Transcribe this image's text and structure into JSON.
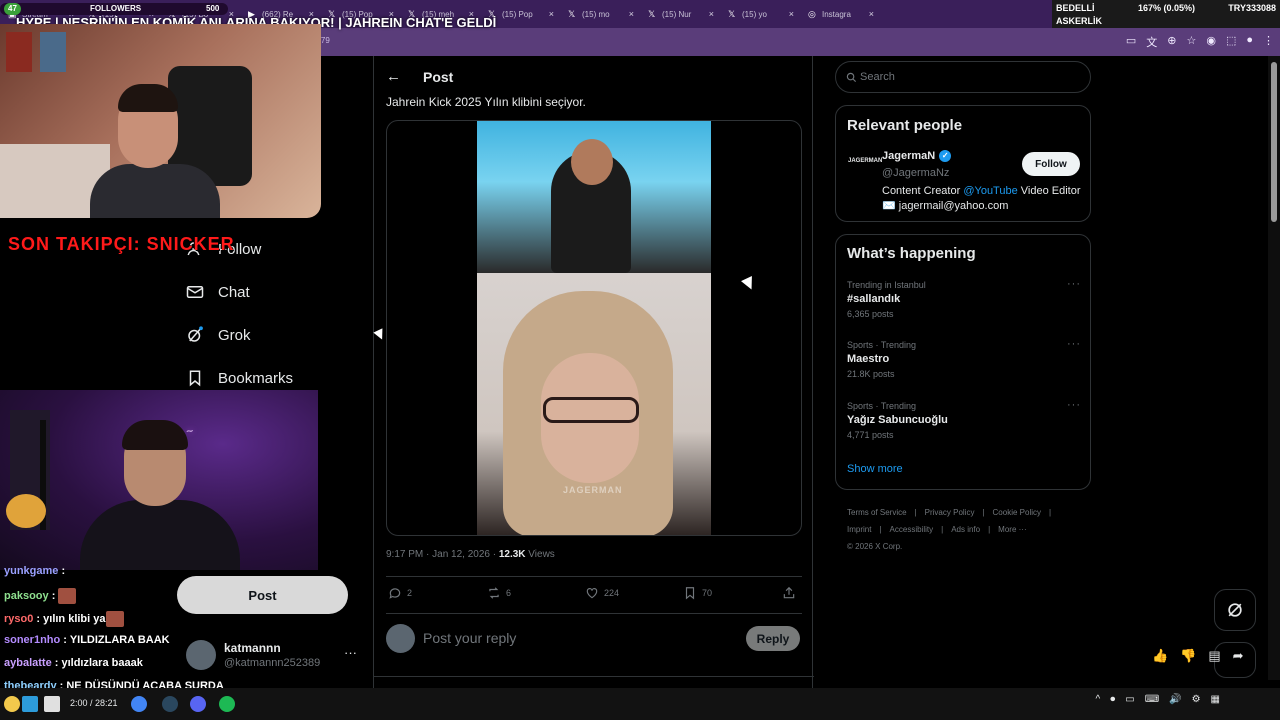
{
  "browser": {
    "tabs": [
      {
        "label": "Stream",
        "icon": "twitch-icon"
      },
      {
        "label": "(15)",
        "icon": "x-logo-icon"
      },
      {
        "label": "(15) Bo",
        "icon": "x-logo-icon"
      },
      {
        "label": "(662) Re",
        "icon": "youtube-icon"
      },
      {
        "label": "(15) Pop",
        "icon": "x-logo-icon"
      },
      {
        "label": "(15) meh",
        "icon": "x-logo-icon"
      },
      {
        "label": "(15) Pop",
        "icon": "x-logo-icon"
      },
      {
        "label": "(15) mo",
        "icon": "x-logo-icon"
      },
      {
        "label": "(15) Nur",
        "icon": "x-logo-icon"
      },
      {
        "label": "(15) yo",
        "icon": "x-logo-icon"
      },
      {
        "label": "Instagra",
        "icon": "instagram-icon"
      }
    ],
    "url_fragment": "1979"
  },
  "ticker": {
    "line1": "BEDELLİ",
    "line2": "ASKERLİK",
    "pct": "167% (0.05%)",
    "symbol": "TRY333088"
  },
  "stream": {
    "title": "HYPE | NESRİN'İN EN KOMİK ANLARINA BAKIYOR! | JAHREIN CHAT'E GELDİ",
    "followers_label": "FOLLOWERS",
    "followers_count": "47",
    "followers_goal": "500",
    "last_follower": "SON TAKIPÇI: SNICKER"
  },
  "nav": {
    "follow_label": "Follow",
    "chat_label": "Chat",
    "grok_label": "Grok",
    "bookmarks_label": "Bookmarks",
    "post_button": "Post"
  },
  "account": {
    "name": "katmannn",
    "handle": "@katmannn252389"
  },
  "post": {
    "header": "Post",
    "text": "Jahrein Kick 2025 Yılın klibini seçiyor.",
    "watermark": "JAGERMAN",
    "time": "9:17 PM · Jan 12, 2026 · ",
    "views": "12.3K",
    "views_label": " Views",
    "replies": "2",
    "reposts": "6",
    "likes": "224",
    "bookmarks": "70",
    "reply_placeholder": "Post your reply",
    "reply_button": "Reply"
  },
  "search": {
    "placeholder": "Search"
  },
  "relevant": {
    "title": "Relevant people",
    "logo_text": "JAGERMAN",
    "name": "JagermaN",
    "handle": "@JagermaNz",
    "bio_1": "Content Creator ",
    "bio_link": "@YouTube",
    "bio_2": " Video Editor ✉️ jagermail@yahoo.com",
    "follow_button": "Follow"
  },
  "happening": {
    "title": "What’s happening",
    "trends": [
      {
        "context": "Trending in Istanbul",
        "name": "#sallandık",
        "count": "6,365 posts"
      },
      {
        "context": "Sports · Trending",
        "name": "Maestro",
        "count": "21.8K posts"
      },
      {
        "context": "Sports · Trending",
        "name": "Yağız Sabuncuoğlu",
        "count": "4,771 posts"
      }
    ],
    "show_more": "Show more"
  },
  "footer": {
    "links": [
      "Terms of Service",
      "Privacy Policy",
      "Cookie Policy",
      "Imprint",
      "Accessibility",
      "Ads info",
      "More ···"
    ],
    "copyright": "© 2026 X Corp."
  },
  "chat": [
    {
      "user": "yunkgame",
      "color": "#9aa0ff",
      "msg": ""
    },
    {
      "user": "paksooy",
      "color": "#8fe08f",
      "msg": ""
    },
    {
      "user": "ryso0",
      "color": "#ff6a6a",
      "msg": "yılın klibi ya"
    },
    {
      "user": "soner1nho",
      "color": "#b48cff",
      "msg": "YILDIZLARA BAAK"
    },
    {
      "user": "aybalatte",
      "color": "#c9a0ff",
      "msg": "yıldızlara baaak"
    },
    {
      "user": "thebeardy",
      "color": "#8fd0ff",
      "msg": "NE DÜŞÜNDÜ ACABA ŞURDA"
    }
  ],
  "taskbar": {
    "media_time": "2:00 / 28:21"
  }
}
